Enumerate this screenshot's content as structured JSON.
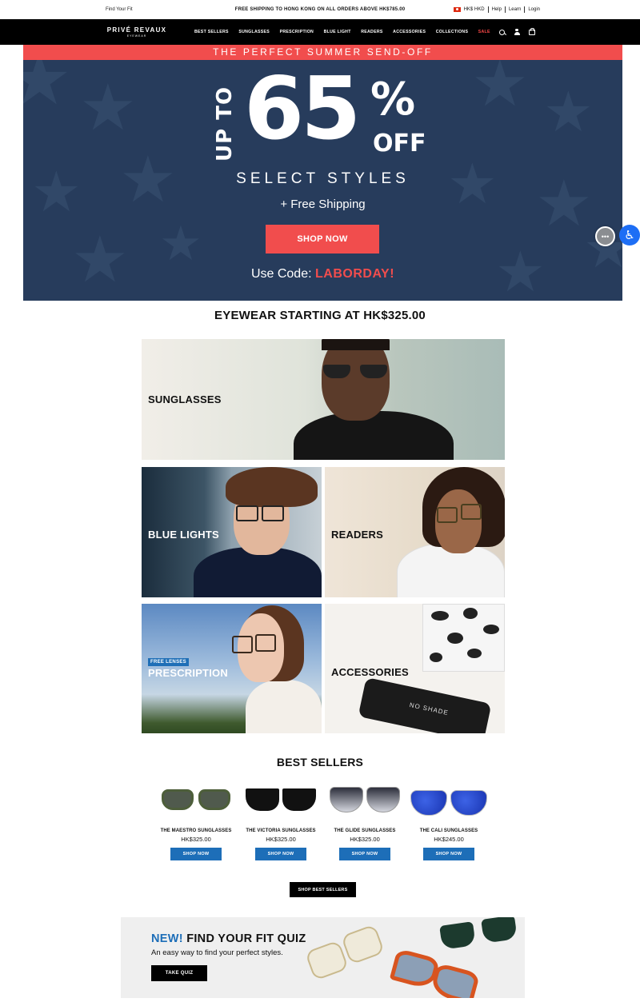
{
  "utility": {
    "find_your_fit": "Find Your Fit",
    "promo": "FREE SHIPPING TO HONG KONG ON ALL ORDERS ABOVE HK$785.00",
    "currency": "HK$ HKD",
    "help": "Help",
    "learn": "Learn",
    "login": "Login"
  },
  "nav": {
    "logo": "PRIVÉ REVAUX",
    "logo_sub": "EYEWEAR",
    "items": [
      "BEST SELLERS",
      "SUNGLASSES",
      "PRESCRIPTION",
      "BLUE LIGHT",
      "READERS",
      "ACCESSORIES",
      "COLLECTIONS",
      "SALE"
    ]
  },
  "hero": {
    "strip": "THE PERFECT SUMMER SEND-OFF",
    "up_to": "UP TO",
    "percent": "65",
    "percent_sign": "%",
    "off": "OFF",
    "select_styles": "SELECT STYLES",
    "free_shipping": "+ Free Shipping",
    "cta": "SHOP NOW",
    "code_prefix": "Use Code: ",
    "code": "LABORDAY!",
    "bg_color": "#273c5c",
    "accent": "#f14d4d"
  },
  "section_title": "EYEWEAR STARTING AT HK$325.00",
  "categories": {
    "sunglasses": "SUNGLASSES",
    "blue_lights": "BLUE LIGHTS",
    "readers": "READERS",
    "prescription_tag": "FREE LENSES",
    "prescription": "PRESCRIPTION",
    "accessories": "ACCESSORIES",
    "case_text": "NO SHADE"
  },
  "best_sellers": {
    "title": "BEST SELLERS",
    "products": [
      {
        "name": "THE MAESTRO SUNGLASSES",
        "price": "HK$325.00",
        "cta": "SHOP NOW"
      },
      {
        "name": "THE VICTORIA SUNGLASSES",
        "price": "HK$325.00",
        "cta": "SHOP NOW"
      },
      {
        "name": "THE GLIDE SUNGLASSES",
        "price": "HK$325.00",
        "cta": "SHOP NOW"
      },
      {
        "name": "THE CALI SUNGLASSES",
        "price": "HK$245.00",
        "cta": "SHOP NOW"
      }
    ],
    "cta": "SHOP BEST SELLERS"
  },
  "quiz": {
    "new": "NEW!",
    "title": " FIND YOUR FIT QUIZ",
    "desc": "An easy way to find your perfect styles.",
    "cta": "TAKE QUIZ"
  },
  "icons": [
    "search-icon",
    "user-icon",
    "bag-icon",
    "chat-icon",
    "accessibility-icon"
  ]
}
